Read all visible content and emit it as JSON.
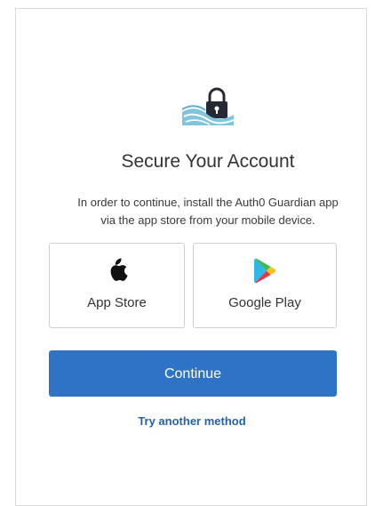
{
  "card": {
    "logo_icon": "lock-waves-icon",
    "title": "Secure Your Account",
    "description_line1": "In order to continue, install the Auth0 Guardian app",
    "description_line2": "via the app store from your mobile device."
  },
  "stores": {
    "apple": {
      "label": "App Store",
      "icon": "apple-icon"
    },
    "google": {
      "label": "Google Play",
      "icon": "google-play-icon"
    }
  },
  "actions": {
    "continue_label": "Continue",
    "try_another_label": "Try another method"
  },
  "colors": {
    "primary": "#2f73c7",
    "link": "#2760a8",
    "logo_teal": "#5aaed0",
    "lock_dark": "#252a35"
  }
}
